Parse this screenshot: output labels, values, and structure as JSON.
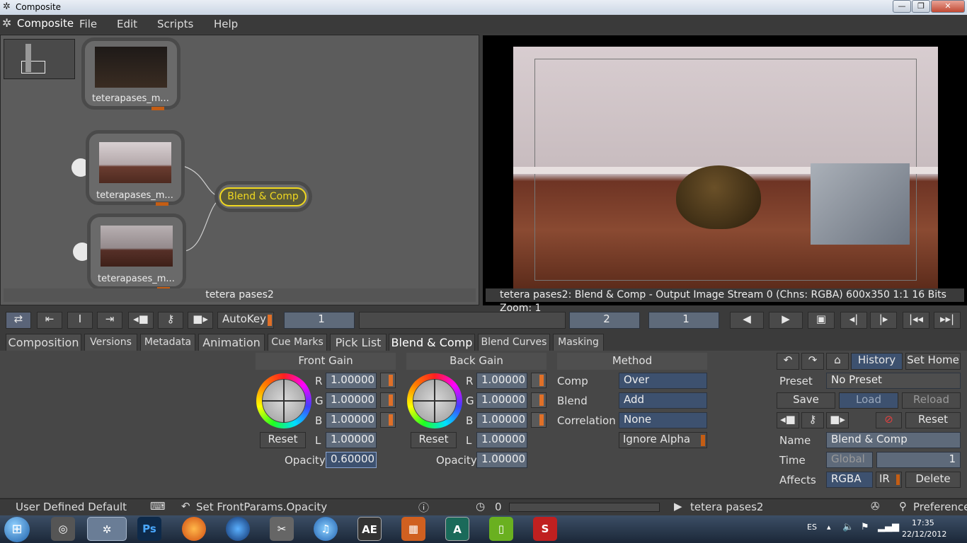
{
  "window": {
    "title": "Composite",
    "min": "—",
    "max": "❐",
    "close": "✕"
  },
  "menu": {
    "app": "Composite",
    "items": [
      "File",
      "Edit",
      "Scripts",
      "Help"
    ]
  },
  "nodes": {
    "n1": "teterapases_m...",
    "n2": "teterapases_m...",
    "n3": "teterapases_m...",
    "blend": "Blend & Comp",
    "footer": "tetera pases2"
  },
  "viewer": {
    "info": "tetera pases2: Blend & Comp - Output Image  Stream 0 (Chns: RGBA)  600x350  1:1  16 Bits  Zoom: 1"
  },
  "timeline": {
    "autokey": "AutoKey",
    "frame1": "1",
    "frame2": "2",
    "frame3": "1"
  },
  "tabs": [
    "Composition",
    "Versions",
    "Metadata",
    "Animation",
    "Cue Marks",
    "Pick List",
    "Blend & Comp",
    "Blend Curves",
    "Masking"
  ],
  "front_gain": {
    "title": "Front Gain",
    "r_label": "R",
    "g_label": "G",
    "b_label": "B",
    "l_label": "L",
    "r": "1.00000",
    "g": "1.00000",
    "b": "1.00000",
    "l": "1.00000",
    "reset": "Reset",
    "opacity_label": "Opacity",
    "opacity": "0.60000"
  },
  "back_gain": {
    "title": "Back Gain",
    "r_label": "R",
    "g_label": "G",
    "b_label": "B",
    "l_label": "L",
    "r": "1.00000",
    "g": "1.00000",
    "b": "1.00000",
    "l": "1.00000",
    "reset": "Reset",
    "opacity_label": "Opacity",
    "opacity": "1.00000"
  },
  "method": {
    "title": "Method",
    "comp_label": "Comp",
    "comp": "Over",
    "blend_label": "Blend",
    "blend": "Add",
    "corr_label": "Correlation",
    "corr": "None",
    "ignore_alpha": "Ignore Alpha"
  },
  "right_panel": {
    "history": "History",
    "set_home": "Set Home",
    "preset_label": "Preset",
    "preset": "No Preset",
    "save": "Save",
    "load": "Load",
    "reload": "Reload",
    "reset": "Reset",
    "name_label": "Name",
    "name": "Blend & Comp",
    "time_label": "Time",
    "time_global": "Global",
    "time_value": "1",
    "affects_label": "Affects",
    "affects": "RGBA",
    "ir": "IR",
    "delete": "Delete"
  },
  "status": {
    "default": "User Defined Default",
    "action": "Set FrontParams.Opacity",
    "counter": "0",
    "clip": "tetera pases2",
    "preferences": "Preferences"
  },
  "taskbar": {
    "lang": "ES",
    "time": "17:35",
    "date": "22/12/2012",
    "ae": "AE",
    "ps": "Ps"
  }
}
